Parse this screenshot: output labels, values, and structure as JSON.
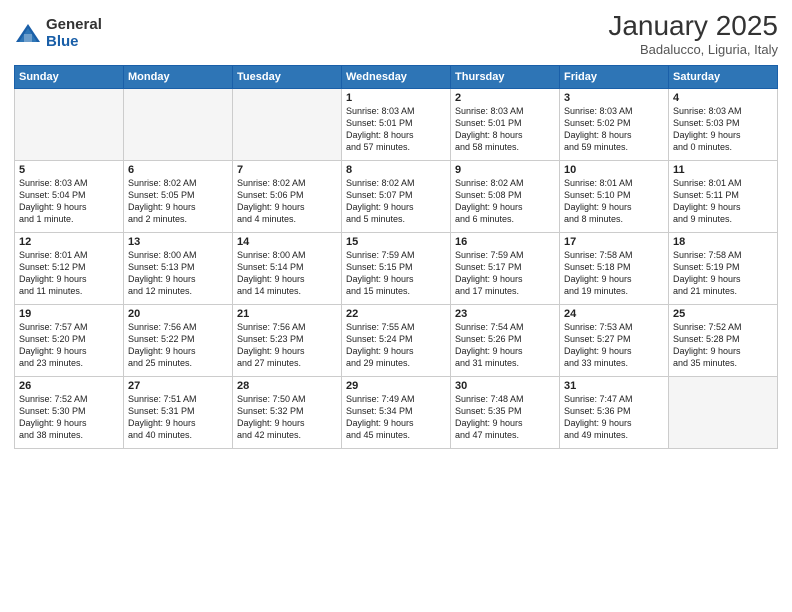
{
  "header": {
    "logo_general": "General",
    "logo_blue": "Blue",
    "month": "January 2025",
    "location": "Badalucco, Liguria, Italy"
  },
  "weekdays": [
    "Sunday",
    "Monday",
    "Tuesday",
    "Wednesday",
    "Thursday",
    "Friday",
    "Saturday"
  ],
  "weeks": [
    [
      {
        "day": "",
        "info": ""
      },
      {
        "day": "",
        "info": ""
      },
      {
        "day": "",
        "info": ""
      },
      {
        "day": "1",
        "info": "Sunrise: 8:03 AM\nSunset: 5:01 PM\nDaylight: 8 hours\nand 57 minutes."
      },
      {
        "day": "2",
        "info": "Sunrise: 8:03 AM\nSunset: 5:01 PM\nDaylight: 8 hours\nand 58 minutes."
      },
      {
        "day": "3",
        "info": "Sunrise: 8:03 AM\nSunset: 5:02 PM\nDaylight: 8 hours\nand 59 minutes."
      },
      {
        "day": "4",
        "info": "Sunrise: 8:03 AM\nSunset: 5:03 PM\nDaylight: 9 hours\nand 0 minutes."
      }
    ],
    [
      {
        "day": "5",
        "info": "Sunrise: 8:03 AM\nSunset: 5:04 PM\nDaylight: 9 hours\nand 1 minute."
      },
      {
        "day": "6",
        "info": "Sunrise: 8:02 AM\nSunset: 5:05 PM\nDaylight: 9 hours\nand 2 minutes."
      },
      {
        "day": "7",
        "info": "Sunrise: 8:02 AM\nSunset: 5:06 PM\nDaylight: 9 hours\nand 4 minutes."
      },
      {
        "day": "8",
        "info": "Sunrise: 8:02 AM\nSunset: 5:07 PM\nDaylight: 9 hours\nand 5 minutes."
      },
      {
        "day": "9",
        "info": "Sunrise: 8:02 AM\nSunset: 5:08 PM\nDaylight: 9 hours\nand 6 minutes."
      },
      {
        "day": "10",
        "info": "Sunrise: 8:01 AM\nSunset: 5:10 PM\nDaylight: 9 hours\nand 8 minutes."
      },
      {
        "day": "11",
        "info": "Sunrise: 8:01 AM\nSunset: 5:11 PM\nDaylight: 9 hours\nand 9 minutes."
      }
    ],
    [
      {
        "day": "12",
        "info": "Sunrise: 8:01 AM\nSunset: 5:12 PM\nDaylight: 9 hours\nand 11 minutes."
      },
      {
        "day": "13",
        "info": "Sunrise: 8:00 AM\nSunset: 5:13 PM\nDaylight: 9 hours\nand 12 minutes."
      },
      {
        "day": "14",
        "info": "Sunrise: 8:00 AM\nSunset: 5:14 PM\nDaylight: 9 hours\nand 14 minutes."
      },
      {
        "day": "15",
        "info": "Sunrise: 7:59 AM\nSunset: 5:15 PM\nDaylight: 9 hours\nand 15 minutes."
      },
      {
        "day": "16",
        "info": "Sunrise: 7:59 AM\nSunset: 5:17 PM\nDaylight: 9 hours\nand 17 minutes."
      },
      {
        "day": "17",
        "info": "Sunrise: 7:58 AM\nSunset: 5:18 PM\nDaylight: 9 hours\nand 19 minutes."
      },
      {
        "day": "18",
        "info": "Sunrise: 7:58 AM\nSunset: 5:19 PM\nDaylight: 9 hours\nand 21 minutes."
      }
    ],
    [
      {
        "day": "19",
        "info": "Sunrise: 7:57 AM\nSunset: 5:20 PM\nDaylight: 9 hours\nand 23 minutes."
      },
      {
        "day": "20",
        "info": "Sunrise: 7:56 AM\nSunset: 5:22 PM\nDaylight: 9 hours\nand 25 minutes."
      },
      {
        "day": "21",
        "info": "Sunrise: 7:56 AM\nSunset: 5:23 PM\nDaylight: 9 hours\nand 27 minutes."
      },
      {
        "day": "22",
        "info": "Sunrise: 7:55 AM\nSunset: 5:24 PM\nDaylight: 9 hours\nand 29 minutes."
      },
      {
        "day": "23",
        "info": "Sunrise: 7:54 AM\nSunset: 5:26 PM\nDaylight: 9 hours\nand 31 minutes."
      },
      {
        "day": "24",
        "info": "Sunrise: 7:53 AM\nSunset: 5:27 PM\nDaylight: 9 hours\nand 33 minutes."
      },
      {
        "day": "25",
        "info": "Sunrise: 7:52 AM\nSunset: 5:28 PM\nDaylight: 9 hours\nand 35 minutes."
      }
    ],
    [
      {
        "day": "26",
        "info": "Sunrise: 7:52 AM\nSunset: 5:30 PM\nDaylight: 9 hours\nand 38 minutes."
      },
      {
        "day": "27",
        "info": "Sunrise: 7:51 AM\nSunset: 5:31 PM\nDaylight: 9 hours\nand 40 minutes."
      },
      {
        "day": "28",
        "info": "Sunrise: 7:50 AM\nSunset: 5:32 PM\nDaylight: 9 hours\nand 42 minutes."
      },
      {
        "day": "29",
        "info": "Sunrise: 7:49 AM\nSunset: 5:34 PM\nDaylight: 9 hours\nand 45 minutes."
      },
      {
        "day": "30",
        "info": "Sunrise: 7:48 AM\nSunset: 5:35 PM\nDaylight: 9 hours\nand 47 minutes."
      },
      {
        "day": "31",
        "info": "Sunrise: 7:47 AM\nSunset: 5:36 PM\nDaylight: 9 hours\nand 49 minutes."
      },
      {
        "day": "",
        "info": ""
      }
    ]
  ]
}
